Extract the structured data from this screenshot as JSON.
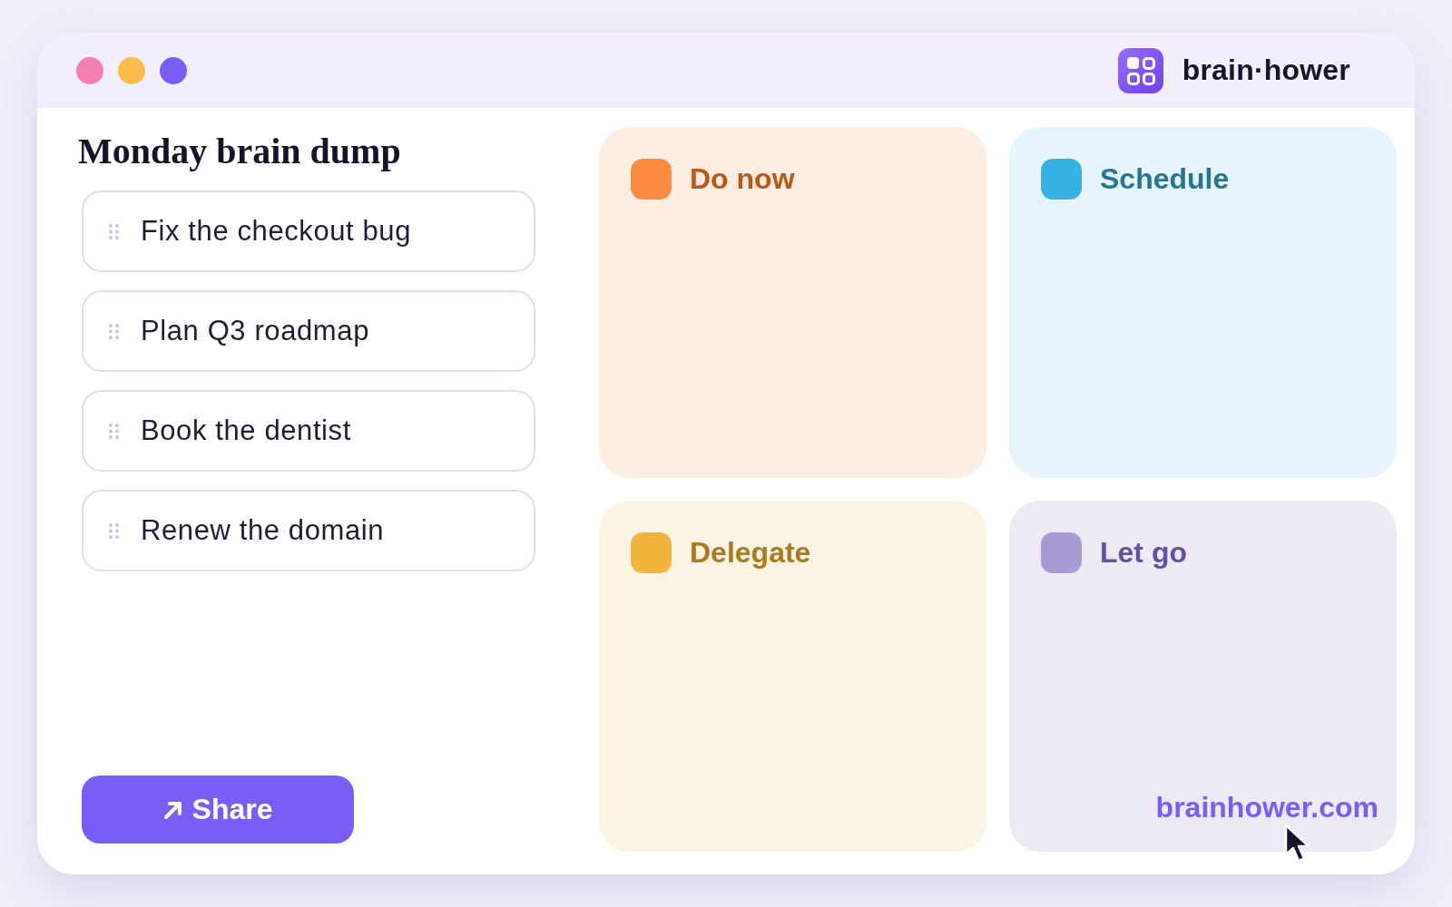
{
  "window": {
    "controls": [
      {
        "color": "#f77fb0"
      },
      {
        "color": "#fdbb48"
      },
      {
        "color": "#7c5cf6"
      }
    ]
  },
  "brand": {
    "name": "brain·hower"
  },
  "dump": {
    "title": "Monday brain dump",
    "items": [
      {
        "text": "Fix the checkout bug"
      },
      {
        "text": "Plan Q3 roadmap"
      },
      {
        "text": "Book the dentist"
      },
      {
        "text": "Renew the domain"
      }
    ]
  },
  "share_button": {
    "label": "Share"
  },
  "quadrants": [
    {
      "label": "Do now",
      "color": "#fd8c42"
    },
    {
      "label": "Schedule",
      "color": "#36b3e3"
    },
    {
      "label": "Delegate",
      "color": "#f2b43c"
    },
    {
      "label": "Let go",
      "color": "#a99ad6",
      "link": "brainhower.com"
    }
  ]
}
